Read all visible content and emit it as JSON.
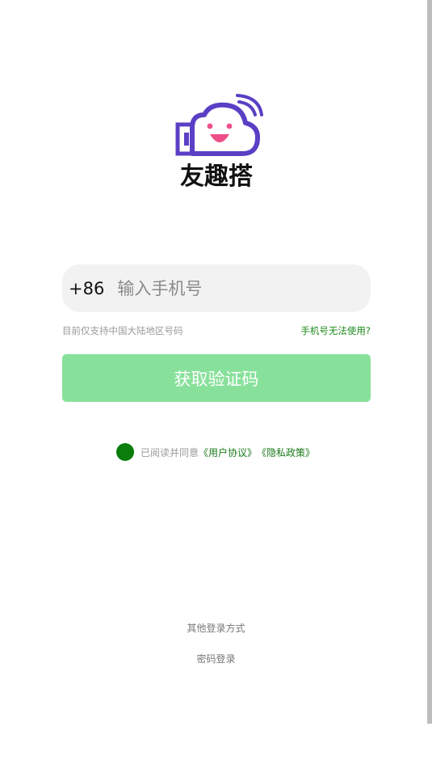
{
  "app": {
    "name": "友趣搭"
  },
  "login": {
    "country_code": "+86",
    "phone_placeholder": "输入手机号",
    "region_hint": "目前仅支持中国大陆地区号码",
    "phone_unavailable": "手机号无法使用?",
    "get_code_label": "获取验证码",
    "agree_text": "已阅读并同意",
    "user_agreement": "《用户协议》",
    "privacy_policy": "《隐私政策》",
    "other_methods": "其他登录方式",
    "password_login": "密码登录"
  },
  "colors": {
    "brand_purple": "#5b3fc4",
    "brand_pink": "#ee4f8b",
    "button_green": "#88e19b",
    "link_green": "#1a7a1a"
  }
}
